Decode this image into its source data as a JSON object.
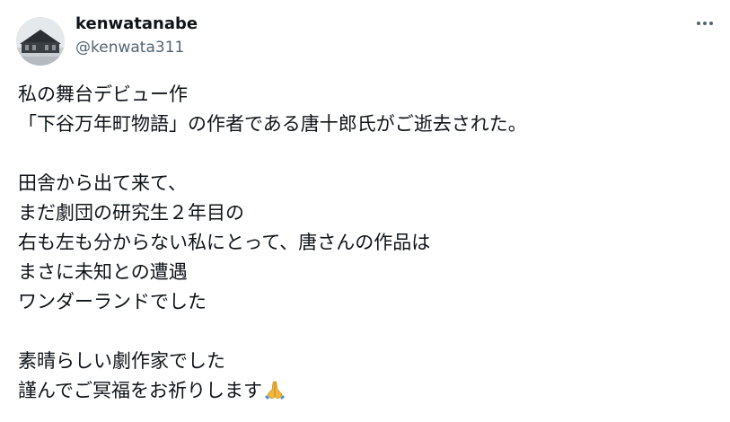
{
  "author": {
    "display_name": "kenwatanabe",
    "handle": "@kenwata311"
  },
  "menu": {
    "icon": "more-horizontal-icon"
  },
  "tweet": {
    "lines": [
      "私の舞台デビュー作",
      "「下谷万年町物語」の作者である唐十郎氏がご逝去された。",
      "",
      "田舎から出て来て、",
      "まだ劇団の研究生２年目の",
      "右も左も分からない私にとって、唐さんの作品は",
      "まさに未知との遭遇",
      "ワンダーランドでした",
      "",
      "素晴らしい劇作家でした",
      "謹んでご冥福をお祈りします"
    ],
    "emoji": "folded-hands-icon"
  },
  "colors": {
    "text": "#0f1419",
    "secondary": "#536471",
    "emoji": "#f5b83d"
  }
}
